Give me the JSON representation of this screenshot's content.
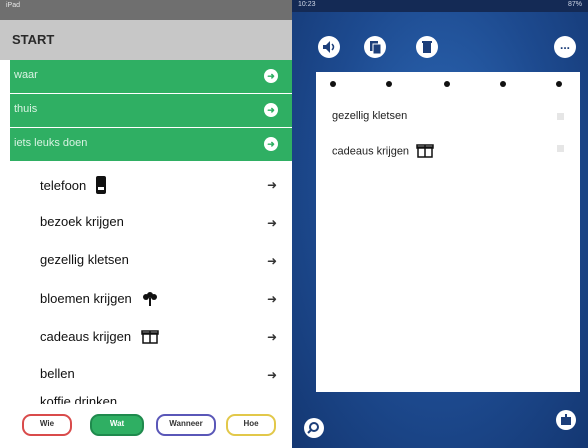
{
  "left": {
    "status": "iPad",
    "start_label": "START",
    "categories": [
      {
        "label": "waar"
      },
      {
        "label": "thuis"
      },
      {
        "label": "iets leuks doen"
      }
    ],
    "items": [
      {
        "label": "telefoon",
        "icon": "phone-icon"
      },
      {
        "label": "bezoek krijgen"
      },
      {
        "label": "gezellig kletsen"
      },
      {
        "label": "bloemen krijgen",
        "icon": "flower-icon"
      },
      {
        "label": "cadeaus krijgen",
        "icon": "gift-icon"
      },
      {
        "label": "bellen"
      },
      {
        "label": "koffie drinken"
      }
    ],
    "tabs": {
      "wie": "Wie",
      "wat": "Wat",
      "wanneer": "Wanneer",
      "hoe": "Hoe"
    },
    "colors": {
      "green": "#2faf63",
      "start_bg": "#c7c7c7",
      "wie": "#d94b4b",
      "wanneer": "#5a57b8",
      "hoe": "#e2c84a"
    }
  },
  "right": {
    "status_time": "10:23",
    "status_batt": "87%",
    "toolbar": [
      "speaker-icon",
      "copy-icon",
      "trash-icon",
      "more-icon"
    ],
    "more_label": "...",
    "card_rows": [
      {
        "label": "gezellig kletsen"
      },
      {
        "label": "cadeaus krijgen",
        "icon": "gift-icon"
      }
    ],
    "bg_colors": [
      "#2e6ab8",
      "#143772"
    ]
  }
}
